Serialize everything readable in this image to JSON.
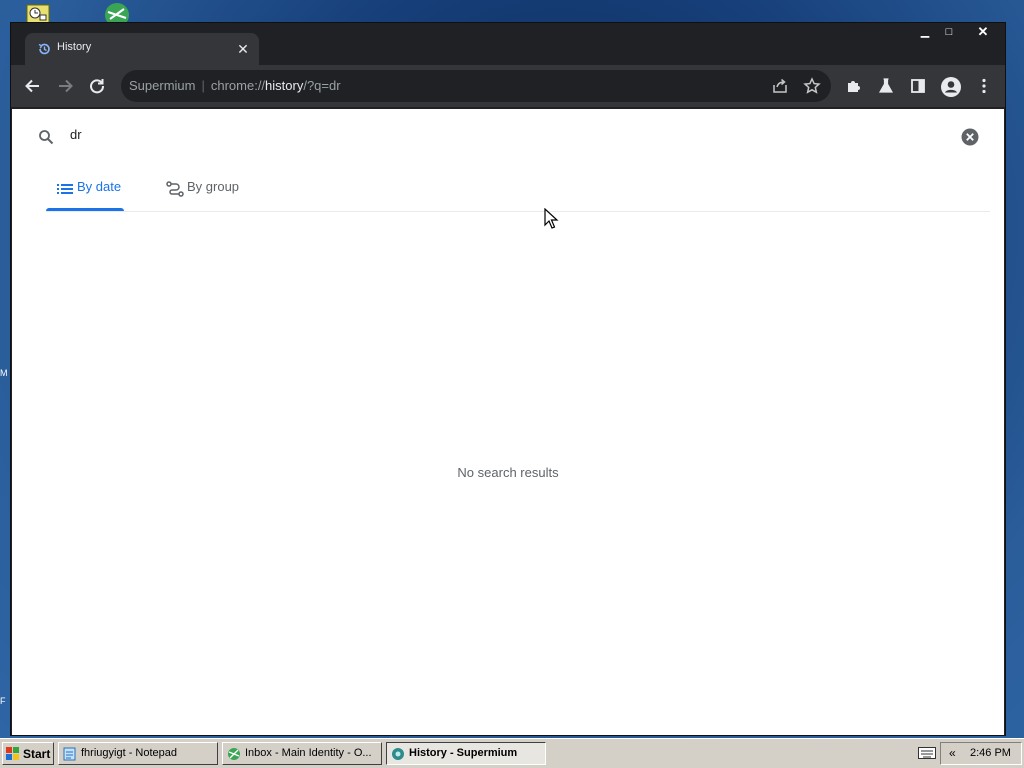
{
  "browser": {
    "tab_title": "History",
    "tab_close": "✕",
    "window_controls": {
      "minimize": "▁",
      "maximize": "□",
      "close": "✕"
    },
    "omnibox": {
      "app_name": "Supermium",
      "separator": "|",
      "scheme": "chrome://",
      "host": "history",
      "path": "/?q=dr"
    }
  },
  "history_page": {
    "search_value": "dr",
    "tabs": [
      {
        "label": "By date",
        "selected": true
      },
      {
        "label": "By group",
        "selected": false
      }
    ],
    "empty_message": "No search results"
  },
  "taskbar": {
    "start_label": "Start",
    "tasks": [
      {
        "label": "fhriugyigt - Notepad",
        "active": false
      },
      {
        "label": "Inbox - Main Identity - O...",
        "active": false
      },
      {
        "label": "History - Supermium",
        "active": true
      }
    ],
    "clock": "2:46 PM",
    "tray_chevron": "«"
  },
  "colors": {
    "accent": "#1a73e8",
    "toolbar": "#35363a",
    "titlebar": "#202124",
    "taskbar": "#d4d0c8"
  }
}
